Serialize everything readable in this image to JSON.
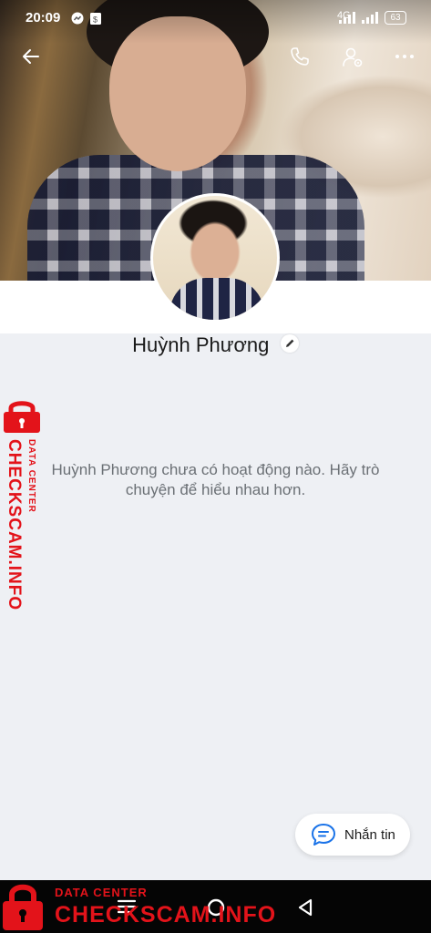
{
  "status_bar": {
    "time": "20:09",
    "network": "4G",
    "battery": "63"
  },
  "profile": {
    "name": "Huỳnh Phương"
  },
  "empty_state": {
    "message": "Huỳnh Phương chưa có hoạt động nào. Hãy trò chuyện để hiểu nhau hơn."
  },
  "actions": {
    "message_button_label": "Nhắn tin"
  },
  "watermark": {
    "line1": "DATA CENTER",
    "line2": "CHECKSCAM.INFO"
  },
  "icons": {
    "back": "back-arrow-icon",
    "call": "phone-icon",
    "profile_settings": "user-settings-icon",
    "more": "more-dots-icon",
    "edit": "pencil-icon",
    "message": "chat-bubble-icon"
  },
  "colors": {
    "accent": "#1a73e8",
    "watermark": "#e3131a",
    "background": "#eef0f4"
  }
}
